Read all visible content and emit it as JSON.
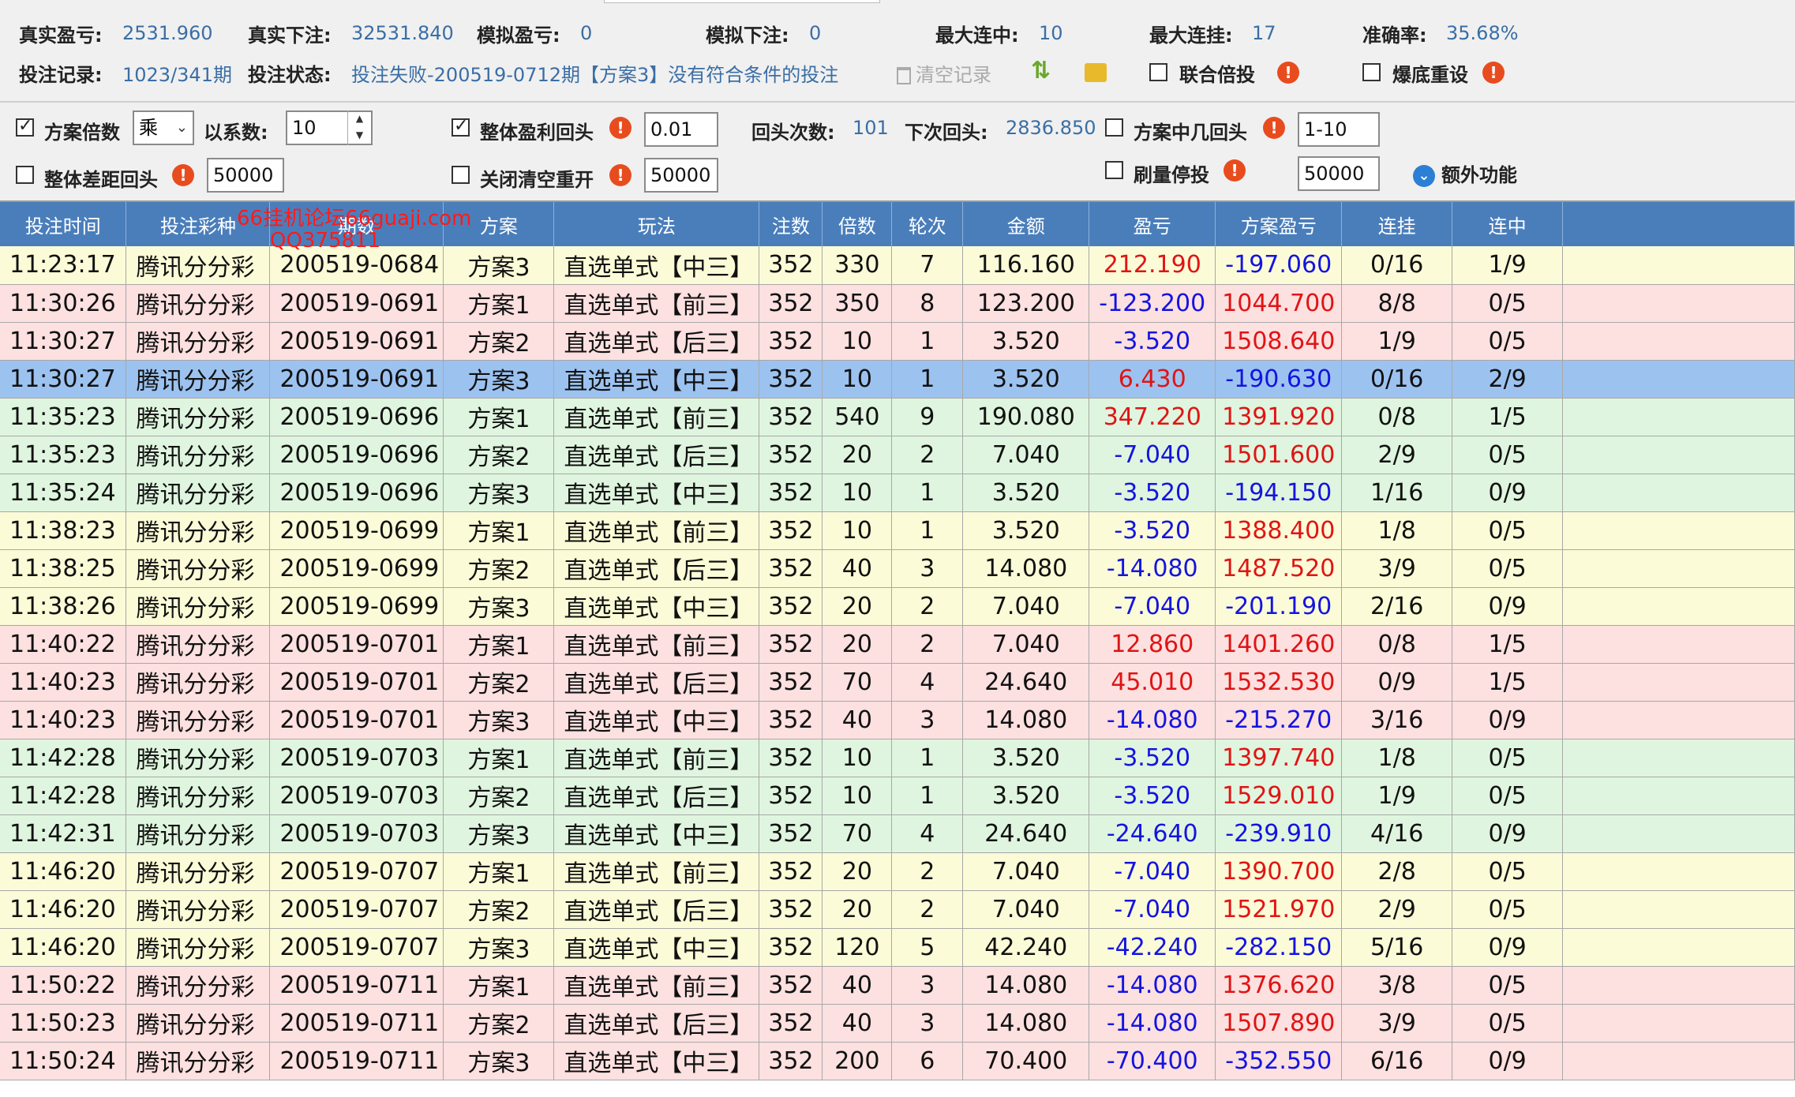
{
  "stats": {
    "real_profit_label": "真实盈亏:",
    "real_profit": "2531.960",
    "real_bet_label": "真实下注:",
    "real_bet": "32531.840",
    "sim_profit_label": "模拟盈亏:",
    "sim_profit": "0",
    "sim_bet_label": "模拟下注:",
    "sim_bet": "0",
    "max_win_label": "最大连中:",
    "max_win": "10",
    "max_lose_label": "最大连挂:",
    "max_lose": "17",
    "accuracy_label": "准确率:",
    "accuracy": "35.68%",
    "record_label": "投注记录:",
    "record": "1023/341期",
    "status_label": "投注状态:",
    "status": "投注失败-200519-0712期【方案3】没有符合条件的投注",
    "clear_label": "清空记录",
    "joint_double_label": "联合倍投",
    "bust_reset_label": "爆底重设"
  },
  "options": {
    "plan_mult_label": "方案倍数",
    "mult_op": "乘",
    "coef_label": "以系数:",
    "coef_value": "10",
    "overall_profit_label": "整体盈利回头",
    "overall_profit_value": "0.01",
    "back_times_label": "回头次数:",
    "back_times": "101",
    "next_back_label": "下次回头:",
    "next_back": "2836.850",
    "plan_hit_label": "方案中几回头",
    "plan_hit_value": "1-10",
    "overall_gap_label": "整体差距回头",
    "overall_gap_value": "50000",
    "close_clear_label": "关闭清空重开",
    "close_clear_value": "50000",
    "brush_stop_label": "刷量停投",
    "brush_stop_value": "50000",
    "extra_label": "额外功能"
  },
  "watermark": {
    "line1": "66挂机论坛66guaji.com",
    "line2": "QQ375811"
  },
  "table": {
    "headers": [
      "投注时间",
      "投注彩种",
      "期数",
      "方案",
      "玩法",
      "注数",
      "倍数",
      "轮次",
      "金额",
      "盈亏",
      "方案盈亏",
      "连挂",
      "连中"
    ],
    "rows": [
      {
        "bg": "yellow",
        "cells": [
          "11:23:17",
          "腾讯分分彩",
          "200519-0684",
          "方案3",
          "直选单式【中三】",
          "352",
          "330",
          "7",
          "116.160",
          "212.190",
          "-197.060",
          "0/16",
          "1/9"
        ]
      },
      {
        "bg": "pink",
        "cells": [
          "11:30:26",
          "腾讯分分彩",
          "200519-0691",
          "方案1",
          "直选单式【前三】",
          "352",
          "350",
          "8",
          "123.200",
          "-123.200",
          "1044.700",
          "8/8",
          "0/5"
        ]
      },
      {
        "bg": "pink",
        "cells": [
          "11:30:27",
          "腾讯分分彩",
          "200519-0691",
          "方案2",
          "直选单式【后三】",
          "352",
          "10",
          "1",
          "3.520",
          "-3.520",
          "1508.640",
          "1/9",
          "0/5"
        ]
      },
      {
        "bg": "blue",
        "cells": [
          "11:30:27",
          "腾讯分分彩",
          "200519-0691",
          "方案3",
          "直选单式【中三】",
          "352",
          "10",
          "1",
          "3.520",
          "6.430",
          "-190.630",
          "0/16",
          "2/9"
        ]
      },
      {
        "bg": "green",
        "cells": [
          "11:35:23",
          "腾讯分分彩",
          "200519-0696",
          "方案1",
          "直选单式【前三】",
          "352",
          "540",
          "9",
          "190.080",
          "347.220",
          "1391.920",
          "0/8",
          "1/5"
        ]
      },
      {
        "bg": "green",
        "cells": [
          "11:35:23",
          "腾讯分分彩",
          "200519-0696",
          "方案2",
          "直选单式【后三】",
          "352",
          "20",
          "2",
          "7.040",
          "-7.040",
          "1501.600",
          "2/9",
          "0/5"
        ]
      },
      {
        "bg": "green",
        "cells": [
          "11:35:24",
          "腾讯分分彩",
          "200519-0696",
          "方案3",
          "直选单式【中三】",
          "352",
          "10",
          "1",
          "3.520",
          "-3.520",
          "-194.150",
          "1/16",
          "0/9"
        ]
      },
      {
        "bg": "yellow",
        "cells": [
          "11:38:23",
          "腾讯分分彩",
          "200519-0699",
          "方案1",
          "直选单式【前三】",
          "352",
          "10",
          "1",
          "3.520",
          "-3.520",
          "1388.400",
          "1/8",
          "0/5"
        ]
      },
      {
        "bg": "yellow",
        "cells": [
          "11:38:25",
          "腾讯分分彩",
          "200519-0699",
          "方案2",
          "直选单式【后三】",
          "352",
          "40",
          "3",
          "14.080",
          "-14.080",
          "1487.520",
          "3/9",
          "0/5"
        ]
      },
      {
        "bg": "yellow",
        "cells": [
          "11:38:26",
          "腾讯分分彩",
          "200519-0699",
          "方案3",
          "直选单式【中三】",
          "352",
          "20",
          "2",
          "7.040",
          "-7.040",
          "-201.190",
          "2/16",
          "0/9"
        ]
      },
      {
        "bg": "pink",
        "cells": [
          "11:40:22",
          "腾讯分分彩",
          "200519-0701",
          "方案1",
          "直选单式【前三】",
          "352",
          "20",
          "2",
          "7.040",
          "12.860",
          "1401.260",
          "0/8",
          "1/5"
        ]
      },
      {
        "bg": "pink",
        "cells": [
          "11:40:23",
          "腾讯分分彩",
          "200519-0701",
          "方案2",
          "直选单式【后三】",
          "352",
          "70",
          "4",
          "24.640",
          "45.010",
          "1532.530",
          "0/9",
          "1/5"
        ]
      },
      {
        "bg": "pink",
        "cells": [
          "11:40:23",
          "腾讯分分彩",
          "200519-0701",
          "方案3",
          "直选单式【中三】",
          "352",
          "40",
          "3",
          "14.080",
          "-14.080",
          "-215.270",
          "3/16",
          "0/9"
        ]
      },
      {
        "bg": "green",
        "cells": [
          "11:42:28",
          "腾讯分分彩",
          "200519-0703",
          "方案1",
          "直选单式【前三】",
          "352",
          "10",
          "1",
          "3.520",
          "-3.520",
          "1397.740",
          "1/8",
          "0/5"
        ]
      },
      {
        "bg": "green",
        "cells": [
          "11:42:28",
          "腾讯分分彩",
          "200519-0703",
          "方案2",
          "直选单式【后三】",
          "352",
          "10",
          "1",
          "3.520",
          "-3.520",
          "1529.010",
          "1/9",
          "0/5"
        ]
      },
      {
        "bg": "green",
        "cells": [
          "11:42:31",
          "腾讯分分彩",
          "200519-0703",
          "方案3",
          "直选单式【中三】",
          "352",
          "70",
          "4",
          "24.640",
          "-24.640",
          "-239.910",
          "4/16",
          "0/9"
        ]
      },
      {
        "bg": "yellow",
        "cells": [
          "11:46:20",
          "腾讯分分彩",
          "200519-0707",
          "方案1",
          "直选单式【前三】",
          "352",
          "20",
          "2",
          "7.040",
          "-7.040",
          "1390.700",
          "2/8",
          "0/5"
        ]
      },
      {
        "bg": "yellow",
        "cells": [
          "11:46:20",
          "腾讯分分彩",
          "200519-0707",
          "方案2",
          "直选单式【后三】",
          "352",
          "20",
          "2",
          "7.040",
          "-7.040",
          "1521.970",
          "2/9",
          "0/5"
        ]
      },
      {
        "bg": "yellow",
        "cells": [
          "11:46:20",
          "腾讯分分彩",
          "200519-0707",
          "方案3",
          "直选单式【中三】",
          "352",
          "120",
          "5",
          "42.240",
          "-42.240",
          "-282.150",
          "5/16",
          "0/9"
        ]
      },
      {
        "bg": "pink",
        "cells": [
          "11:50:22",
          "腾讯分分彩",
          "200519-0711",
          "方案1",
          "直选单式【前三】",
          "352",
          "40",
          "3",
          "14.080",
          "-14.080",
          "1376.620",
          "3/8",
          "0/5"
        ]
      },
      {
        "bg": "pink",
        "cells": [
          "11:50:23",
          "腾讯分分彩",
          "200519-0711",
          "方案2",
          "直选单式【后三】",
          "352",
          "40",
          "3",
          "14.080",
          "-14.080",
          "1507.890",
          "3/9",
          "0/5"
        ]
      },
      {
        "bg": "pink",
        "cells": [
          "11:50:24",
          "腾讯分分彩",
          "200519-0711",
          "方案3",
          "直选单式【中三】",
          "352",
          "200",
          "6",
          "70.400",
          "-70.400",
          "-352.550",
          "6/16",
          "0/9"
        ]
      }
    ]
  }
}
